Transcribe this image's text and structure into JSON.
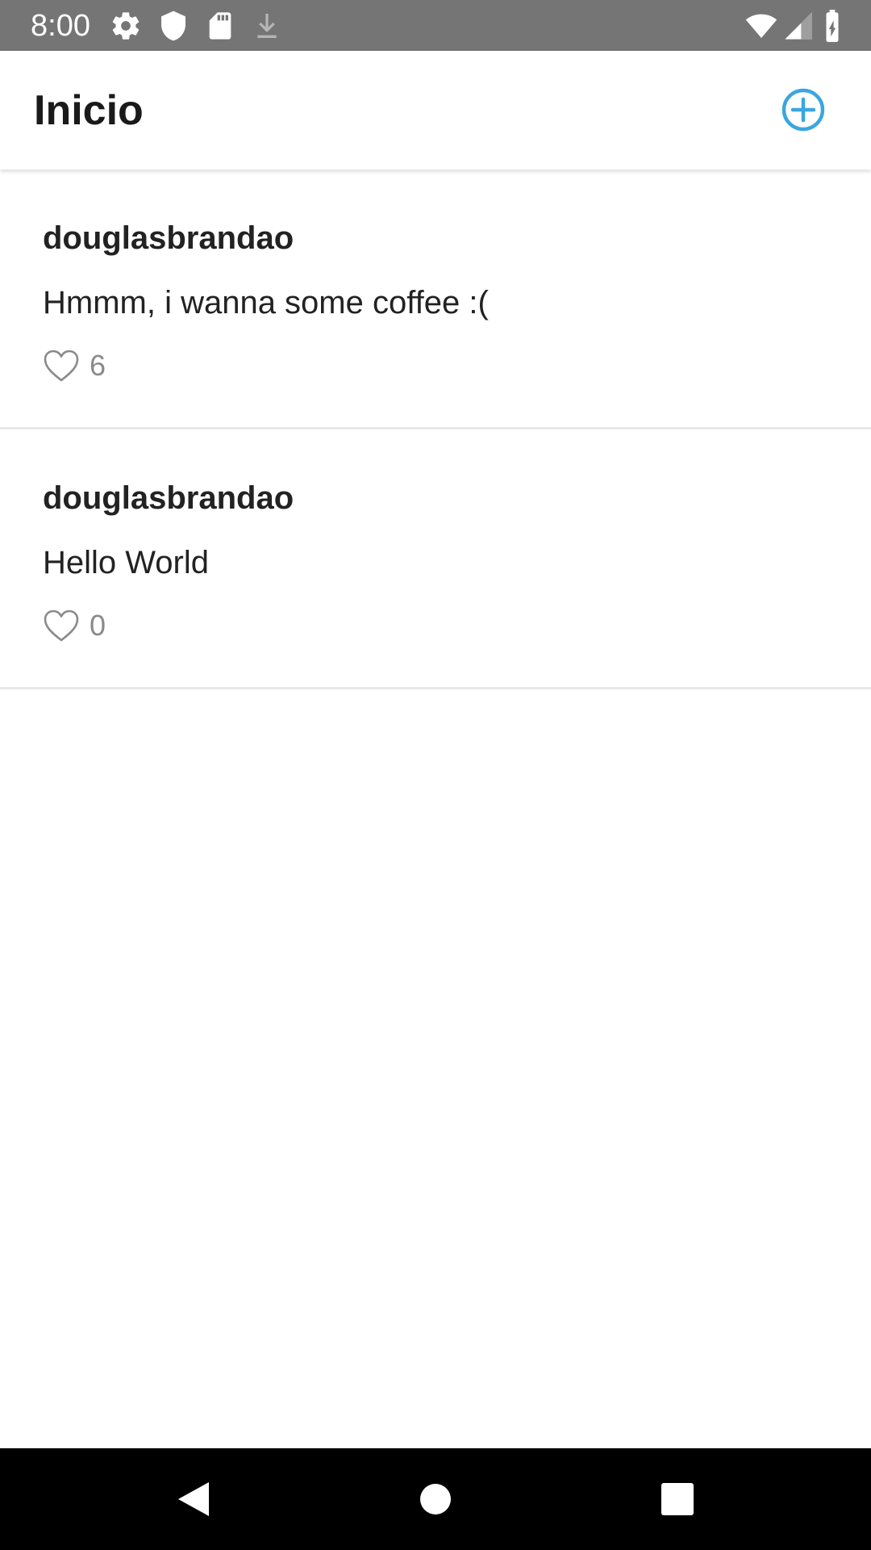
{
  "status_bar": {
    "time": "8:00",
    "icons": [
      "gear-icon",
      "shield-icon",
      "sd-card-icon",
      "download-icon",
      "wifi-icon",
      "signal-icon",
      "battery-charging-icon"
    ]
  },
  "app_bar": {
    "title": "Inicio",
    "add_icon": "plus-circle-icon"
  },
  "posts": [
    {
      "author": "douglasbrandao",
      "text": "Hmmm, i wanna some coffee :(",
      "likes": "6"
    },
    {
      "author": "douglasbrandao",
      "text": "Hello World",
      "likes": "0"
    }
  ],
  "nav_bar": {
    "icons": [
      "back-icon",
      "home-icon",
      "recents-icon"
    ]
  },
  "colors": {
    "status_bar": "#757575",
    "accent": "#3aa6e0",
    "text_primary": "#222222",
    "text_secondary": "#8a8a8a",
    "divider": "#e8e8e8",
    "nav_bar": "#000000"
  }
}
